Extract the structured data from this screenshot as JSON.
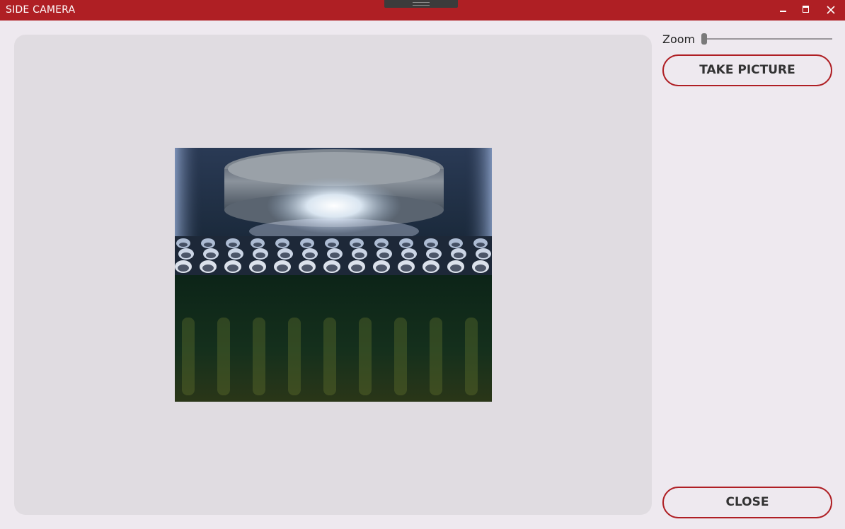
{
  "window": {
    "title": "SIDE CAMERA"
  },
  "colors": {
    "accent": "#af1f24",
    "background": "#eee9ef",
    "viewport": "#e0dce1"
  },
  "icons": {
    "minimize": "minimize-icon",
    "maximize": "maximize-icon",
    "close": "close-icon"
  },
  "controls": {
    "zoom_label": "Zoom",
    "zoom_value": 0,
    "take_picture_label": "TAKE PICTURE",
    "close_label": "CLOSE"
  }
}
